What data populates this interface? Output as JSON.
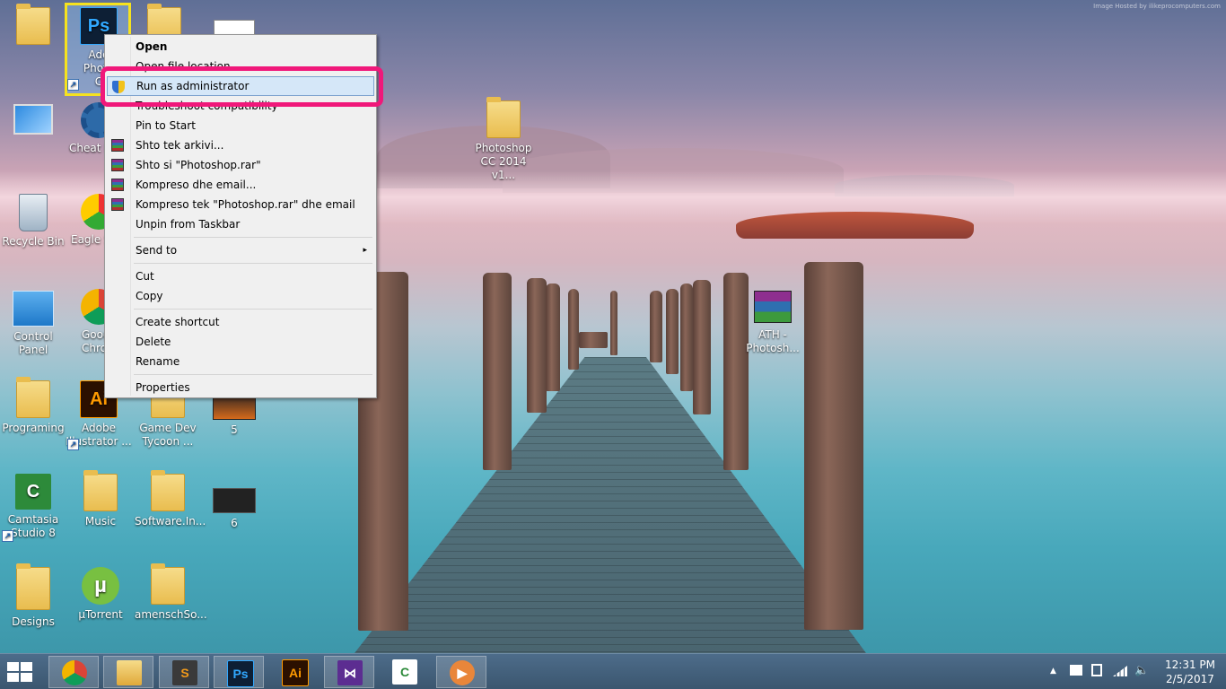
{
  "watermark": "Image Hosted by ilikeprocomputers.com",
  "desktop_icons": [
    {
      "label": "",
      "col": 0
    },
    {
      "label": "Adobe Photoshop CC",
      "label_visible_top": "Ado",
      "label_line2": "Photo",
      "label_line3": "C"
    },
    {
      "label": ""
    },
    {
      "label": ""
    },
    {
      "label": "",
      "lines": [
        "Cheat E"
      ]
    },
    {
      "label": "Photoshop CC 2014 v1...",
      "lines": [
        "Photoshop",
        "CC 2014 v1..."
      ]
    },
    {
      "label": "Recycle Bin"
    },
    {
      "label": "Eagle S"
    },
    {
      "label": "Control Panel",
      "lines": [
        "Control",
        "Panel"
      ]
    },
    {
      "label": "Google Chrome",
      "lines": [
        "Goog",
        "Chro"
      ]
    },
    {
      "label": "ATH - Photosh...",
      "lines": [
        "ATH -",
        "Photosh..."
      ]
    },
    {
      "label": "Programing"
    },
    {
      "label": "Adobe Illustrator ...",
      "lines": [
        "Adobe",
        "Illustrator ..."
      ]
    },
    {
      "label": "Game Dev Tycoon ...",
      "lines": [
        "Game Dev",
        "Tycoon ..."
      ]
    },
    {
      "label": "5"
    },
    {
      "label": "Camtasia Studio 8",
      "lines": [
        "Camtasia",
        "Studio 8"
      ]
    },
    {
      "label": "Music"
    },
    {
      "label": "Software.In..."
    },
    {
      "label": "6"
    },
    {
      "label": "Designs"
    },
    {
      "label": "µTorrent"
    },
    {
      "label": "amenschSo..."
    }
  ],
  "context_menu": {
    "items": [
      {
        "label": "Open",
        "bold": true
      },
      {
        "label": "Open file location"
      },
      {
        "label": "Run as administrator",
        "icon": "uac-shield-icon",
        "highlighted": true
      },
      {
        "label": "Troubleshoot compatibility"
      },
      {
        "label": "Pin to Start"
      },
      {
        "label": "Shto tek arkivi...",
        "icon": "winrar-icon"
      },
      {
        "label": "Shto si \"Photoshop.rar\"",
        "icon": "winrar-icon"
      },
      {
        "label": "Kompreso dhe email...",
        "icon": "winrar-icon"
      },
      {
        "label": "Kompreso tek \"Photoshop.rar\" dhe email",
        "icon": "winrar-icon"
      },
      {
        "label": "Unpin from Taskbar"
      },
      {
        "label": "Send to",
        "submenu": true
      },
      {
        "label": "Cut"
      },
      {
        "label": "Copy"
      },
      {
        "label": "Create shortcut"
      },
      {
        "label": "Delete"
      },
      {
        "label": "Rename"
      },
      {
        "label": "Properties"
      }
    ],
    "submenu_arrow": "▸"
  },
  "taskbar": {
    "apps": [
      {
        "name": "chrome-icon",
        "glyph": ""
      },
      {
        "name": "file-explorer-icon",
        "glyph": ""
      },
      {
        "name": "sublime-text-icon",
        "glyph": "S"
      },
      {
        "name": "photoshop-icon",
        "glyph": "Ps"
      },
      {
        "name": "illustrator-icon",
        "glyph": "Ai"
      },
      {
        "name": "visual-studio-icon",
        "glyph": "⋈"
      },
      {
        "name": "camtasia-icon",
        "glyph": "C"
      },
      {
        "name": "media-player-icon",
        "glyph": "▶"
      }
    ],
    "tray_chevron": "▲",
    "clock_time": "12:31 PM",
    "clock_date": "2/5/2017"
  }
}
